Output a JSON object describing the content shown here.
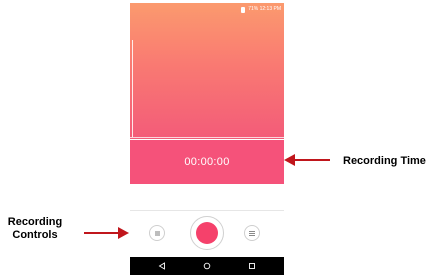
{
  "status_bar": {
    "text": "71% 12:13 PM"
  },
  "recorder": {
    "elapsed_time": "00:00:00"
  },
  "nav_bar": {
    "back": "back",
    "home": "home",
    "recents": "recents"
  },
  "annotations": {
    "recording_time": "Recording Time",
    "recording_controls_line1": "Recording",
    "recording_controls_line2": "Controls"
  },
  "colors": {
    "gradient_top": "#fb9a6e",
    "gradient_bottom": "#f35b79",
    "accent": "#f5416b",
    "arrow": "#c0161c"
  },
  "icons": {
    "stop": "stop-icon",
    "record": "record-icon",
    "list": "list-icon",
    "battery": "battery-icon",
    "nav_back": "triangle-back-icon",
    "nav_home": "circle-home-icon",
    "nav_recents": "square-recents-icon"
  }
}
